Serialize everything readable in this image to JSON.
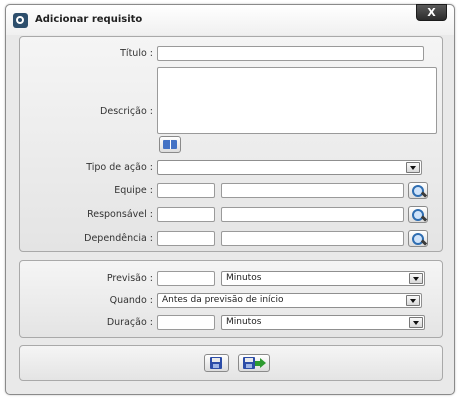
{
  "dialog": {
    "title": "Adicionar requisito",
    "close_label": "X"
  },
  "form": {
    "titulo_label": "Título :",
    "titulo_value": "",
    "descricao_label": "Descrição :",
    "descricao_value": "",
    "tipo_acao_label": "Tipo de ação :",
    "tipo_acao_value": "",
    "equipe_label": "Equipe :",
    "equipe_code": "",
    "equipe_name": "",
    "responsavel_label": "Responsável :",
    "responsavel_code": "",
    "responsavel_name": "",
    "dependencia_label": "Dependência :",
    "dependencia_code": "",
    "dependencia_name": ""
  },
  "timing": {
    "previsao_label": "Previsão :",
    "previsao_value": "",
    "previsao_unit": "Minutos",
    "quando_label": "Quando :",
    "quando_value": "Antes da previsão de início",
    "duracao_label": "Duração :",
    "duracao_value": "",
    "duracao_unit": "Minutos"
  },
  "icons": {
    "app": "app-logo-icon",
    "description_help": "book-icon",
    "lookup": "magnifier-icon",
    "save": "floppy-disk-icon",
    "save_and_close": "floppy-disk-arrow-icon"
  },
  "colors": {
    "dialog_background": "#e9e9e9",
    "close_button": "#3a3a3a",
    "save_icon": "#2c4da8",
    "arrow_icon": "#2d9b30"
  }
}
